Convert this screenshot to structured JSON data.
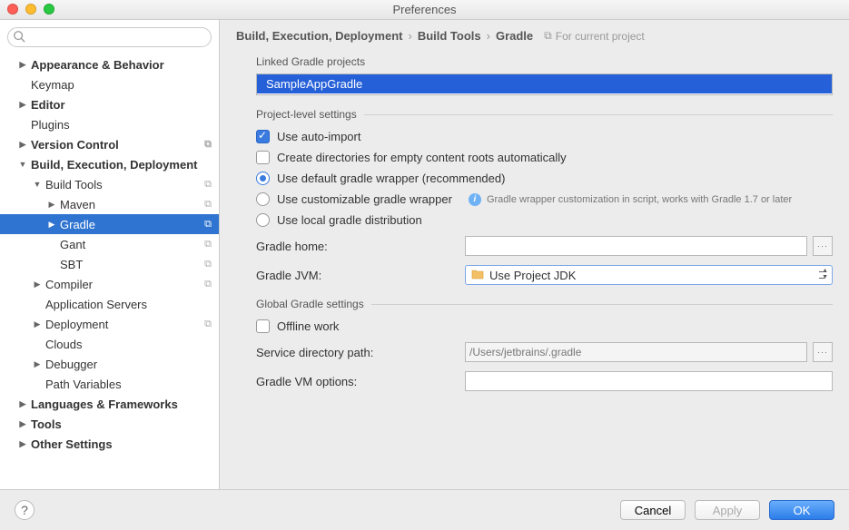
{
  "window": {
    "title": "Preferences"
  },
  "search": {
    "placeholder": ""
  },
  "tree": {
    "appearance": "Appearance & Behavior",
    "keymap": "Keymap",
    "editor": "Editor",
    "plugins": "Plugins",
    "version_control": "Version Control",
    "bed": "Build, Execution, Deployment",
    "build_tools": "Build Tools",
    "maven": "Maven",
    "gradle": "Gradle",
    "gant": "Gant",
    "sbt": "SBT",
    "compiler": "Compiler",
    "app_servers": "Application Servers",
    "deployment": "Deployment",
    "clouds": "Clouds",
    "debugger": "Debugger",
    "path_vars": "Path Variables",
    "lang_fw": "Languages & Frameworks",
    "tools": "Tools",
    "other": "Other Settings"
  },
  "breadcrumb": {
    "a": "Build, Execution, Deployment",
    "b": "Build Tools",
    "c": "Gradle",
    "scope": "For current project"
  },
  "sections": {
    "linked": "Linked Gradle projects",
    "project_level": "Project-level settings",
    "global": "Global Gradle settings"
  },
  "linked_project": "SampleAppGradle",
  "options": {
    "auto_import": "Use auto-import",
    "create_dirs": "Create directories for empty content roots automatically",
    "use_default_wrapper": "Use default gradle wrapper (recommended)",
    "use_custom_wrapper": "Use customizable gradle wrapper",
    "custom_wrapper_hint": "Gradle wrapper customization in script, works with Gradle 1.7 or later",
    "use_local": "Use local gradle distribution",
    "offline": "Offline work"
  },
  "fields": {
    "gradle_home": "Gradle home:",
    "gradle_jvm": "Gradle JVM:",
    "jvm_value": "Use Project JDK",
    "service_dir": "Service directory path:",
    "service_dir_value": "/Users/jetbrains/.gradle",
    "vm_options": "Gradle VM options:"
  },
  "buttons": {
    "cancel": "Cancel",
    "apply": "Apply",
    "ok": "OK"
  }
}
